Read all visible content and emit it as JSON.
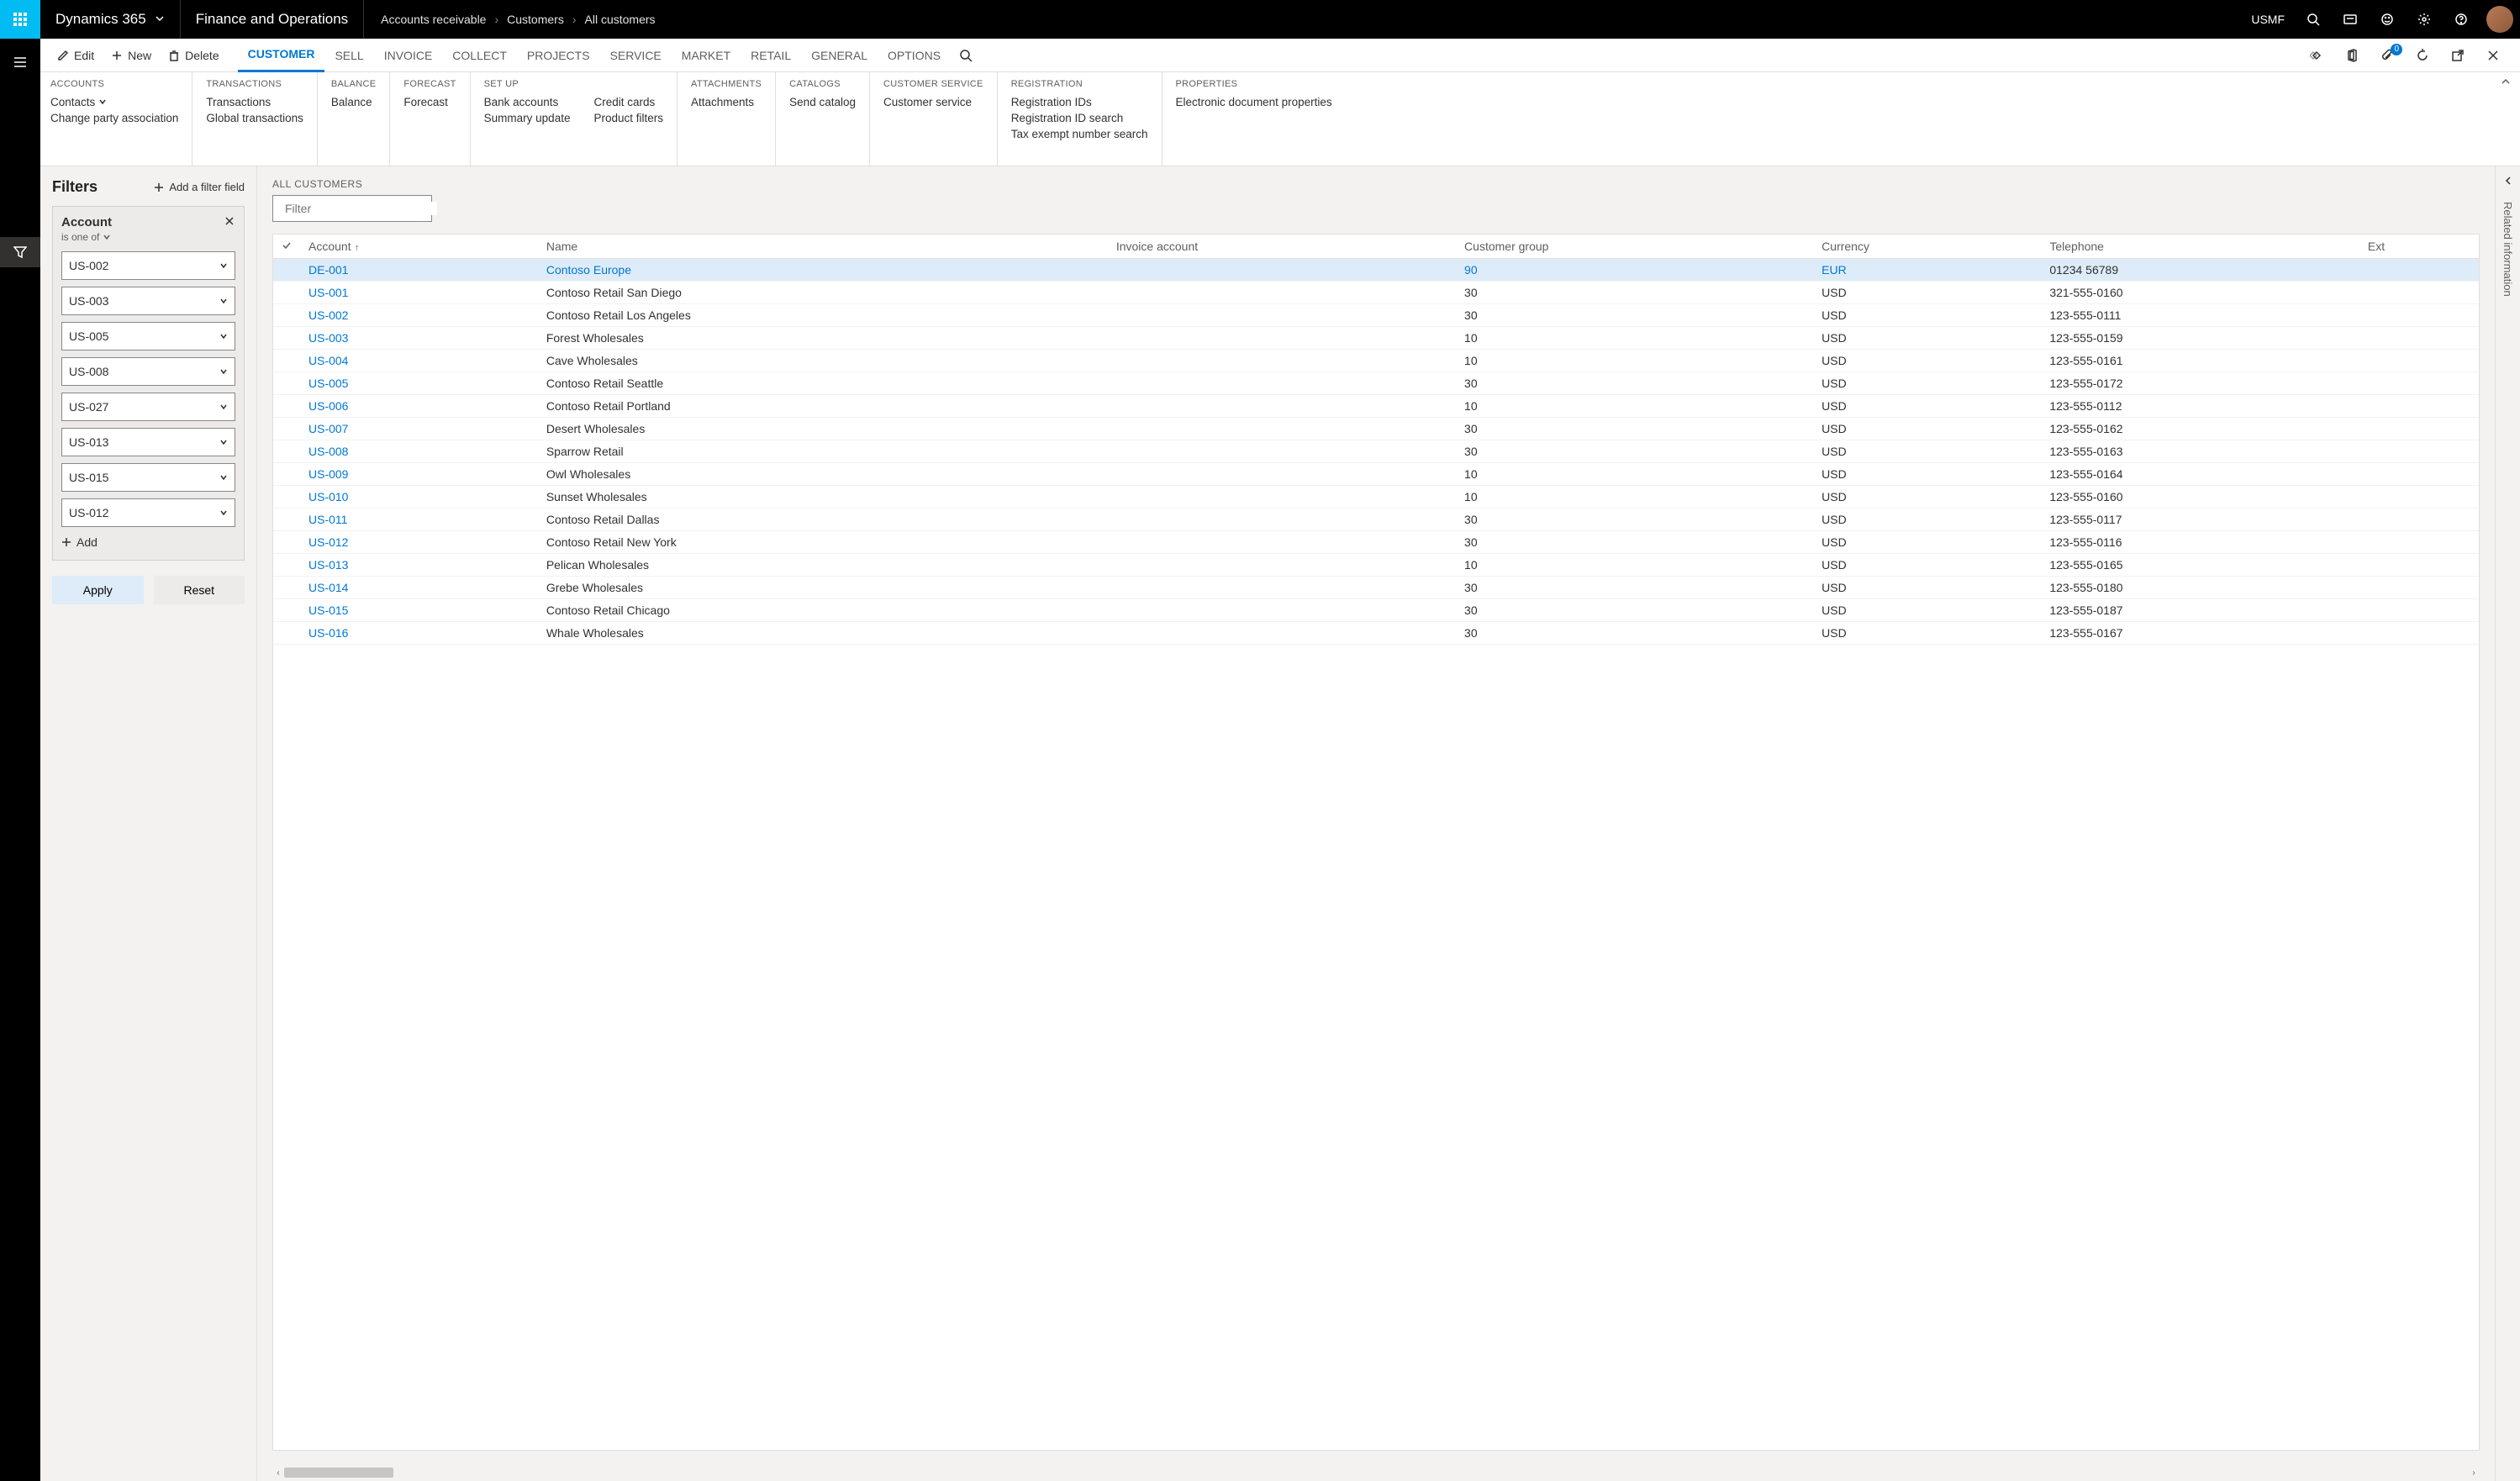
{
  "header": {
    "brand": "Dynamics 365",
    "module": "Finance and Operations",
    "breadcrumb": [
      "Accounts receivable",
      "Customers",
      "All customers"
    ],
    "company": "USMF"
  },
  "actions": {
    "edit": "Edit",
    "new": "New",
    "delete": "Delete",
    "tabs": [
      "CUSTOMER",
      "SELL",
      "INVOICE",
      "COLLECT",
      "PROJECTS",
      "SERVICE",
      "MARKET",
      "RETAIL",
      "GENERAL",
      "OPTIONS"
    ],
    "notification_count": "0"
  },
  "ribbon": {
    "groups": [
      {
        "title": "ACCOUNTS",
        "cols": [
          [
            "Contacts",
            "Change party association"
          ]
        ]
      },
      {
        "title": "TRANSACTIONS",
        "cols": [
          [
            "Transactions",
            "Global transactions"
          ]
        ]
      },
      {
        "title": "BALANCE",
        "cols": [
          [
            "Balance"
          ]
        ]
      },
      {
        "title": "FORECAST",
        "cols": [
          [
            "Forecast"
          ]
        ]
      },
      {
        "title": "SET UP",
        "cols": [
          [
            "Bank accounts",
            "Summary update"
          ],
          [
            "Credit cards",
            "Product filters"
          ]
        ]
      },
      {
        "title": "ATTACHMENTS",
        "cols": [
          [
            "Attachments"
          ]
        ]
      },
      {
        "title": "CATALOGS",
        "cols": [
          [
            "Send catalog"
          ]
        ]
      },
      {
        "title": "CUSTOMER SERVICE",
        "cols": [
          [
            "Customer service"
          ]
        ]
      },
      {
        "title": "REGISTRATION",
        "cols": [
          [
            "Registration IDs",
            "Registration ID search",
            "Tax exempt number search"
          ]
        ]
      },
      {
        "title": "PROPERTIES",
        "cols": [
          [
            "Electronic document properties"
          ]
        ]
      }
    ]
  },
  "filters": {
    "title": "Filters",
    "add_field": "Add a filter field",
    "card": {
      "field": "Account",
      "operator": "is one of",
      "values": [
        "US-002",
        "US-003",
        "US-005",
        "US-008",
        "US-027",
        "US-013",
        "US-015",
        "US-012"
      ],
      "add": "Add"
    },
    "apply": "Apply",
    "reset": "Reset"
  },
  "grid": {
    "caption": "ALL CUSTOMERS",
    "filter_placeholder": "Filter",
    "columns": [
      "Account",
      "Name",
      "Invoice account",
      "Customer group",
      "Currency",
      "Telephone",
      "Ext"
    ],
    "rows": [
      {
        "account": "DE-001",
        "name": "Contoso Europe",
        "invoice": "",
        "group": "90",
        "currency": "EUR",
        "tel": "01234 56789",
        "selected": true
      },
      {
        "account": "US-001",
        "name": "Contoso Retail San Diego",
        "invoice": "",
        "group": "30",
        "currency": "USD",
        "tel": "321-555-0160"
      },
      {
        "account": "US-002",
        "name": "Contoso Retail Los Angeles",
        "invoice": "",
        "group": "30",
        "currency": "USD",
        "tel": "123-555-0111"
      },
      {
        "account": "US-003",
        "name": "Forest Wholesales",
        "invoice": "",
        "group": "10",
        "currency": "USD",
        "tel": "123-555-0159"
      },
      {
        "account": "US-004",
        "name": "Cave Wholesales",
        "invoice": "",
        "group": "10",
        "currency": "USD",
        "tel": "123-555-0161"
      },
      {
        "account": "US-005",
        "name": "Contoso Retail Seattle",
        "invoice": "",
        "group": "30",
        "currency": "USD",
        "tel": "123-555-0172"
      },
      {
        "account": "US-006",
        "name": "Contoso Retail Portland",
        "invoice": "",
        "group": "10",
        "currency": "USD",
        "tel": "123-555-0112"
      },
      {
        "account": "US-007",
        "name": "Desert Wholesales",
        "invoice": "",
        "group": "30",
        "currency": "USD",
        "tel": "123-555-0162"
      },
      {
        "account": "US-008",
        "name": "Sparrow Retail",
        "invoice": "",
        "group": "30",
        "currency": "USD",
        "tel": "123-555-0163"
      },
      {
        "account": "US-009",
        "name": "Owl Wholesales",
        "invoice": "",
        "group": "10",
        "currency": "USD",
        "tel": "123-555-0164"
      },
      {
        "account": "US-010",
        "name": "Sunset Wholesales",
        "invoice": "",
        "group": "10",
        "currency": "USD",
        "tel": "123-555-0160"
      },
      {
        "account": "US-011",
        "name": "Contoso Retail Dallas",
        "invoice": "",
        "group": "30",
        "currency": "USD",
        "tel": "123-555-0117"
      },
      {
        "account": "US-012",
        "name": "Contoso Retail New York",
        "invoice": "",
        "group": "30",
        "currency": "USD",
        "tel": "123-555-0116"
      },
      {
        "account": "US-013",
        "name": "Pelican Wholesales",
        "invoice": "",
        "group": "10",
        "currency": "USD",
        "tel": "123-555-0165"
      },
      {
        "account": "US-014",
        "name": "Grebe Wholesales",
        "invoice": "",
        "group": "30",
        "currency": "USD",
        "tel": "123-555-0180"
      },
      {
        "account": "US-015",
        "name": "Contoso Retail Chicago",
        "invoice": "",
        "group": "30",
        "currency": "USD",
        "tel": "123-555-0187"
      },
      {
        "account": "US-016",
        "name": "Whale Wholesales",
        "invoice": "",
        "group": "30",
        "currency": "USD",
        "tel": "123-555-0167"
      }
    ]
  },
  "related": {
    "label": "Related information"
  }
}
